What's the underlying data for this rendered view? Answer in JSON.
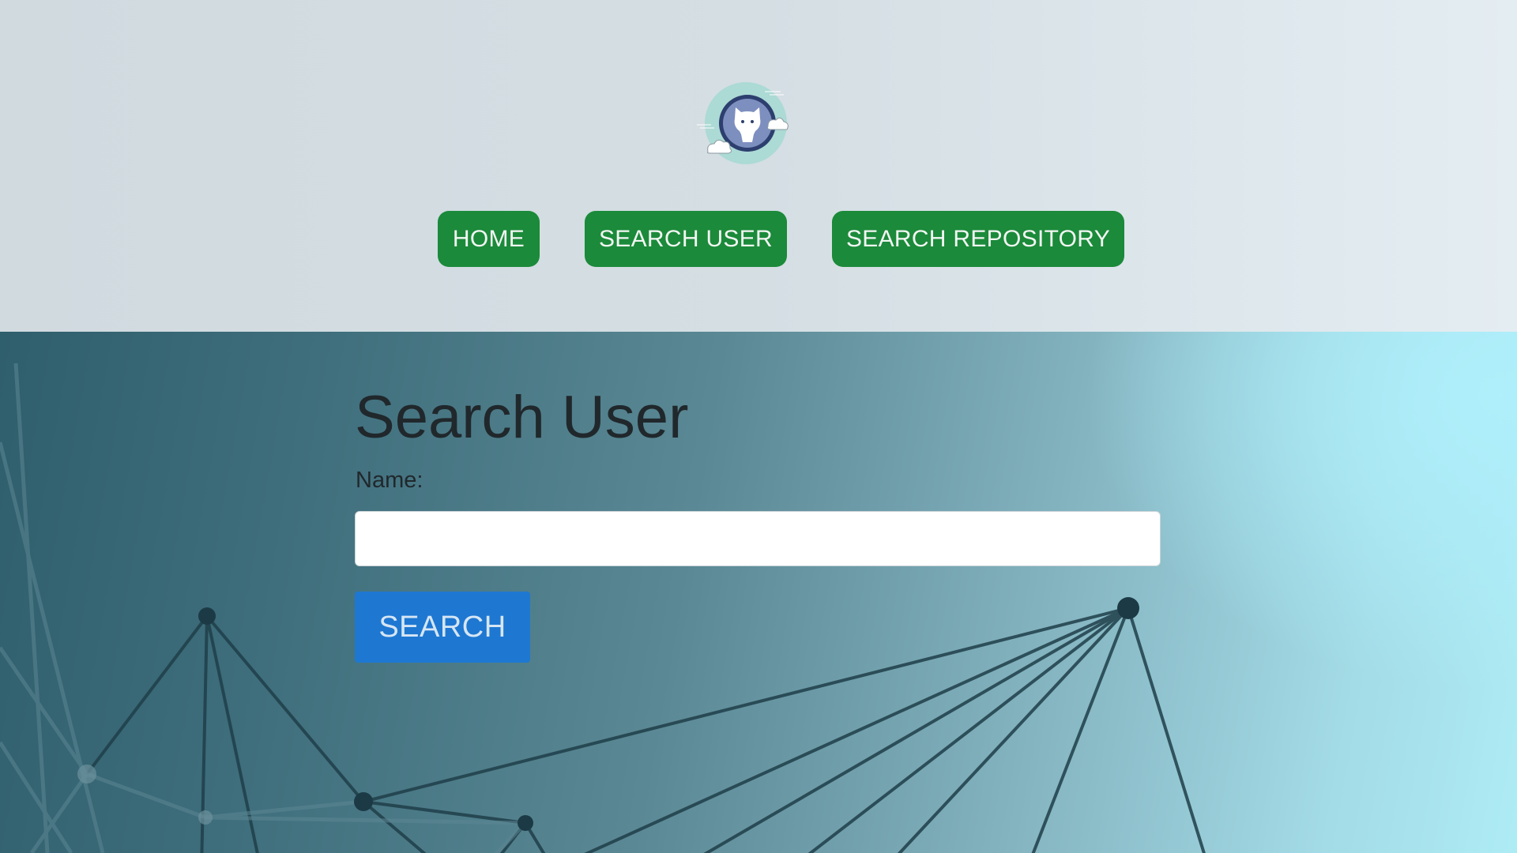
{
  "header": {
    "logo_icon": "github-octocat-cloud-logo",
    "nav": {
      "home_label": "HOME",
      "search_user_label": "SEARCH USER",
      "search_repo_label": "SEARCH REPOSITORY"
    }
  },
  "main": {
    "title": "Search User",
    "name_label": "Name:",
    "name_value": "",
    "name_placeholder": "",
    "search_button_label": "SEARCH"
  },
  "colors": {
    "nav_button": "#1b8a3a",
    "search_button": "#1e78d2",
    "header_bg": "#d4dee3",
    "main_bg_dark": "#2f5e6c",
    "main_bg_light": "#aeecf5"
  }
}
